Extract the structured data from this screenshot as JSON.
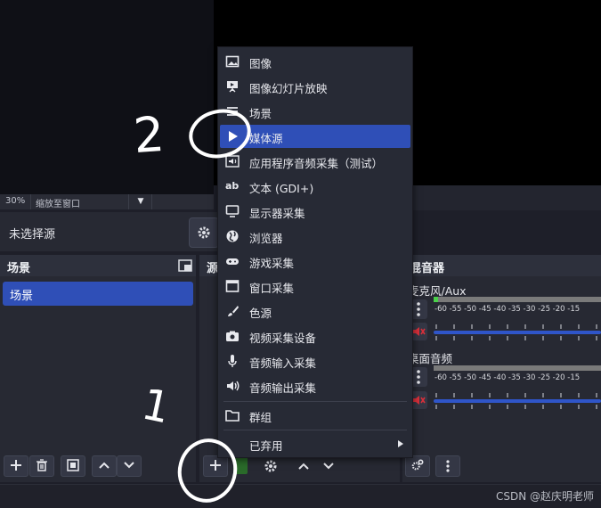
{
  "preview": {
    "zoom": "30%",
    "fit_label": "缩放至窗口"
  },
  "source_bar": {
    "label": "未选择源"
  },
  "scenes": {
    "title": "场景",
    "items": [
      "场景"
    ]
  },
  "sources": {
    "title": "源"
  },
  "mixer": {
    "title": "混音器",
    "channels": [
      {
        "name": "麦克风/Aux"
      },
      {
        "name": "桌面音频"
      }
    ],
    "ticks": "-60 -55 -50 -45 -40 -35 -30 -25 -20 -15"
  },
  "menu": {
    "items": [
      {
        "label": "图像",
        "icon": "image-icon"
      },
      {
        "label": "图像幻灯片放映",
        "icon": "slideshow-icon"
      },
      {
        "label": "场景",
        "icon": "list-icon"
      },
      {
        "label": "媒体源",
        "icon": "play-icon"
      },
      {
        "label": "应用程序音频采集（测试）",
        "icon": "app-audio-icon"
      },
      {
        "label": "文本 (GDI+)",
        "icon": "text-icon"
      },
      {
        "label": "显示器采集",
        "icon": "monitor-icon"
      },
      {
        "label": "浏览器",
        "icon": "globe-icon"
      },
      {
        "label": "游戏采集",
        "icon": "gamepad-icon"
      },
      {
        "label": "窗口采集",
        "icon": "window-icon"
      },
      {
        "label": "色源",
        "icon": "brush-icon"
      },
      {
        "label": "视频采集设备",
        "icon": "camera-icon"
      },
      {
        "label": "音频输入采集",
        "icon": "microphone-icon"
      },
      {
        "label": "音频输出采集",
        "icon": "speaker-icon"
      },
      {
        "label": "群组",
        "icon": "folder-icon"
      },
      {
        "label": "已弃用",
        "icon": "chevron-right-icon"
      }
    ]
  },
  "annotations": {
    "one": "1",
    "two": "2"
  },
  "watermark": "CSDN @赵庆明老师",
  "colors": {
    "accent": "#2f4fb7",
    "background": "#1e1f29",
    "panel": "#272933"
  }
}
